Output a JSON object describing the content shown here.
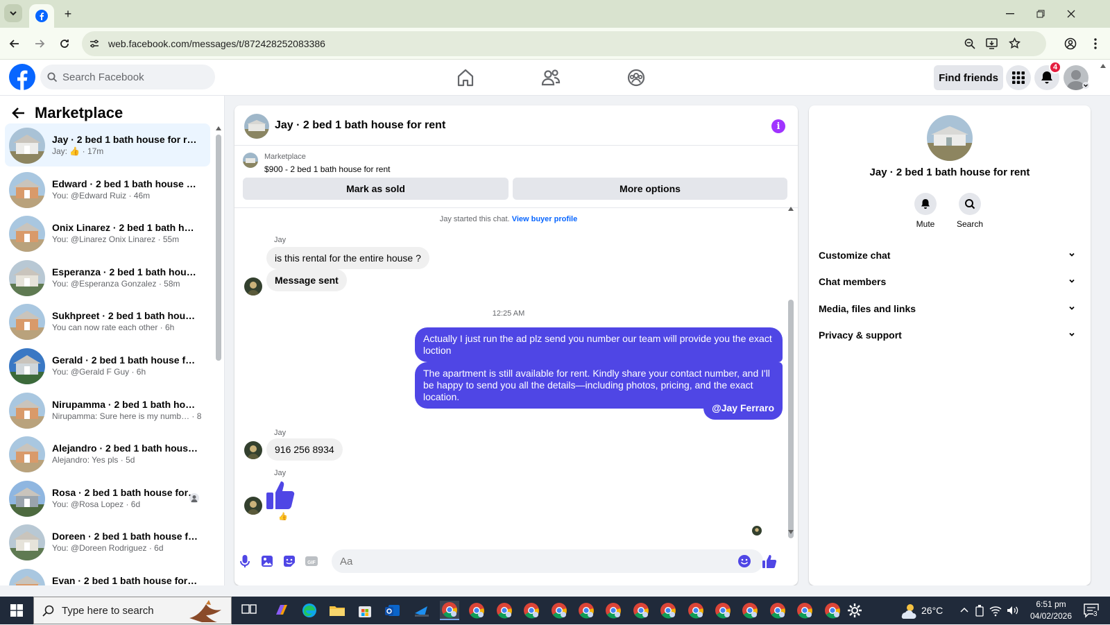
{
  "browser": {
    "url": "web.facebook.com/messages/t/872428252083386",
    "new_tab_label": "+"
  },
  "fb": {
    "search_placeholder": "Search Facebook",
    "find_friends": "Find friends",
    "notification_count": "4",
    "brand_color": "#0866ff"
  },
  "left": {
    "title": "Marketplace",
    "conversations": [
      {
        "name": "Jay · 2 bed 1 bath house for rent",
        "sub": "Jay: 👍 · 17m",
        "active": true
      },
      {
        "name": "Edward · 2 bed 1 bath house for …",
        "sub": "You: @Edward Ruiz · 46m"
      },
      {
        "name": "Onix Linarez · 2 bed 1 bath hous…",
        "sub": "You: @Linarez Onix Linarez · 55m"
      },
      {
        "name": "Esperanza · 2 bed 1 bath house f…",
        "sub": "You: @Esperanza Gonzalez · 58m"
      },
      {
        "name": "Sukhpreet · 2 bed 1 bath house f…",
        "sub": "You can now rate each other · 6h"
      },
      {
        "name": "Gerald · 2 bed 1 bath house for r…",
        "sub": "You: @Gerald F Guy · 6h"
      },
      {
        "name": "Nirupamma · 2 bed 1 bath hous…",
        "sub": "Nirupamma: Sure here is my numb… · 8h"
      },
      {
        "name": "Alejandro · 2 bed 1 bath house f…",
        "sub": "Alejandro: Yes pls · 5d"
      },
      {
        "name": "Rosa · 2 bed 1 bath house for …",
        "sub": "You: @Rosa Lopez · 6d"
      },
      {
        "name": "Doreen · 2 bed 1 bath house for …",
        "sub": "You: @Doreen Rodriguez · 6d"
      },
      {
        "name": "Evan · 2 bed 1 bath house for rent",
        "sub": ""
      }
    ]
  },
  "chat": {
    "title": "Jay · 2 bed 1 bath house for rent",
    "marketplace_label": "Marketplace",
    "listing": "$900 - 2 bed 1 bath house for rent",
    "mark_sold": "Mark as sold",
    "more_options": "More options",
    "started": "Jay started this chat.",
    "view_profile": "View buyer profile",
    "sender": "Jay",
    "msg1": "is this rental for the entire house ?",
    "msg2": "Message sent",
    "time": "12:25 AM",
    "out1": "Actually I  just run the ad  plz  send you number  our team  will provide  you the exact loction",
    "out2": "The apartment is still available for rent. Kindly share your contact number, and I'll be happy to send you all the details—including photos, pricing, and the exact location.",
    "out3": "@Jay Ferraro",
    "msg3": "916 256 8934",
    "input_placeholder": "Aa",
    "accent": "#4f46e5"
  },
  "right": {
    "title": "Jay · 2 bed 1 bath house for rent",
    "mute": "Mute",
    "search": "Search",
    "sections": [
      "Customize chat",
      "Chat members",
      "Media, files and links",
      "Privacy & support"
    ]
  },
  "taskbar": {
    "search_placeholder": "Type here to search",
    "temperature": "26°C",
    "time": "6:51 pm",
    "date": "04/02/2026",
    "notif_count": "3"
  }
}
